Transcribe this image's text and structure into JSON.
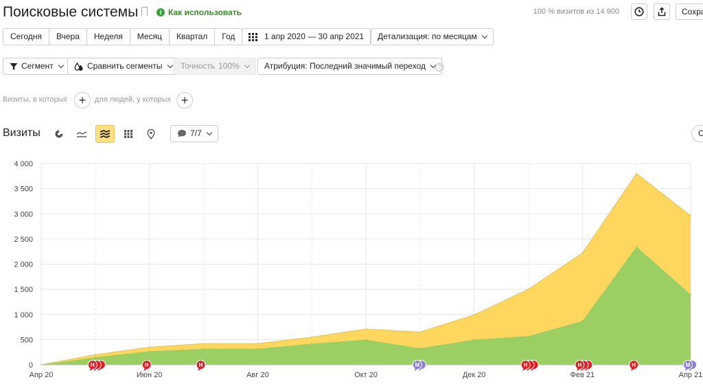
{
  "header": {
    "title": "Поисковые системы",
    "howto_label": "Как использовать",
    "visits_info": "100 % визитов из 14 900",
    "save_label": "Сохра"
  },
  "periods": [
    "Сегодня",
    "Вчера",
    "Неделя",
    "Месяц",
    "Квартал",
    "Год"
  ],
  "date_range": "1 апр 2020 — 30 апр 2021",
  "detail": "Детализация: по месяцам",
  "filters": {
    "segment": "Сегмент",
    "compare": "Сравнить сегменты",
    "accuracy_label": "Точность",
    "accuracy_value": "100%",
    "attribution": "Атрибуция: Последний значимый переход"
  },
  "conditions": {
    "visits_where": "Визиты, в которых",
    "people_where": "для людей, у которых"
  },
  "section": {
    "title": "Визиты",
    "annotations_count": "7/7",
    "right_stub": "С"
  },
  "icons": [
    "bookmark-icon",
    "info-icon",
    "clock-icon",
    "share-icon",
    "calendar-grid-icon",
    "funnel-icon",
    "compare-drops-icon",
    "pie-chart-icon",
    "line-chart-icon",
    "stacked-area-icon",
    "bar-chart-icon",
    "map-pin-icon",
    "comment-icon",
    "plus-icon",
    "question-icon"
  ],
  "colors": {
    "green_series": "#9bcf63",
    "yellow_series": "#ffd75e",
    "annotation_red": "#e31b23",
    "annotation_purple": "#8a7fd6",
    "howto_green": "#3aa33a"
  },
  "chart_data": {
    "type": "area",
    "stacked": true,
    "x": [
      "2020-04-01",
      "2020-05-01",
      "2020-06-01",
      "2020-07-01",
      "2020-08-01",
      "2020-09-01",
      "2020-10-01",
      "2020-11-01",
      "2020-12-01",
      "2021-01-01",
      "2021-02-01",
      "2021-03-01",
      "2021-04-01"
    ],
    "x_tick_labels": [
      "Апр 20",
      "Июн 20",
      "Авг 20",
      "Окт 20",
      "Дек 20",
      "Фев 21",
      "Апр 21"
    ],
    "y_tick_labels": [
      "0",
      "500",
      "1 000",
      "1 500",
      "2 000",
      "2 500",
      "3 000",
      "3 500",
      "4 000"
    ],
    "ylim": [
      0,
      4000
    ],
    "series": [
      {
        "color": "#9bcf63",
        "values": [
          0,
          150,
          270,
          320,
          320,
          420,
          500,
          330,
          500,
          570,
          870,
          2350,
          1400
        ]
      },
      {
        "color": "#ffd75e",
        "values": [
          0,
          50,
          80,
          100,
          100,
          130,
          210,
          320,
          490,
          930,
          1350,
          1450,
          1560
        ]
      }
    ],
    "grid": true,
    "annotations": [
      {
        "date": "2020-05-01",
        "labels": [
          "Н",
          "",
          ""
        ],
        "color": "#e31b23"
      },
      {
        "date": "2020-06-01",
        "labels": [
          "Н"
        ],
        "color": "#e31b23"
      },
      {
        "date": "2020-07-01",
        "labels": [
          "Н"
        ],
        "color": "#e31b23"
      },
      {
        "date": "2020-11-01",
        "labels": [
          "М",
          ""
        ],
        "color": "#8a7fd6"
      },
      {
        "date": "2021-01-01",
        "labels": [
          "Н",
          "",
          ""
        ],
        "color": "#e31b23"
      },
      {
        "date": "2021-02-01",
        "labels": [
          "Н",
          "",
          ""
        ],
        "color": "#e31b23"
      },
      {
        "date": "2021-03-01",
        "labels": [
          "Н"
        ],
        "color": "#e31b23"
      },
      {
        "date": "2021-04-01",
        "labels": [
          "М",
          ""
        ],
        "color": "#8a7fd6"
      }
    ]
  }
}
